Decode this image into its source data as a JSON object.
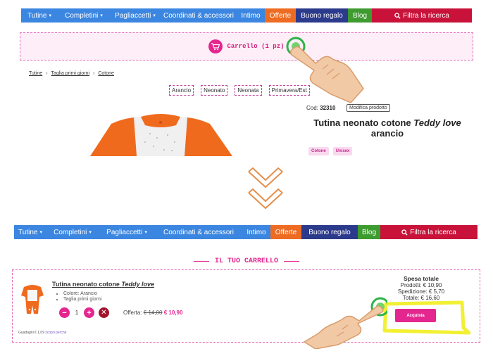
{
  "nav_top": {
    "items": [
      {
        "label": "Tutine",
        "caret": "▾",
        "kind": "blue"
      },
      {
        "label": "Completini",
        "caret": "▾",
        "kind": "blue"
      },
      {
        "label": "Pagliaccetti",
        "caret": "▾",
        "kind": "blue"
      },
      {
        "label": "Coordinati & accessori",
        "caret": "",
        "kind": "blue"
      },
      {
        "label": "Intimo",
        "caret": "",
        "kind": "blue"
      },
      {
        "label": "Offerte",
        "caret": "",
        "kind": "org"
      },
      {
        "label": "Buono regalo",
        "caret": "",
        "kind": "navy"
      },
      {
        "label": "Blog",
        "caret": "",
        "kind": "grn"
      },
      {
        "label": "Filtra la ricerca",
        "caret": "",
        "kind": "red",
        "icon": "search-icon"
      }
    ]
  },
  "cart_bar": {
    "label": "Carrello (1 pz)",
    "icon": "cart-icon"
  },
  "breadcrumb": [
    "Tutine",
    "Taglia primi giorni",
    "Cotone"
  ],
  "breadcrumb_sep": "›",
  "chips": [
    "Arancio",
    "Neonato",
    "Neonata",
    "Primavera/Est"
  ],
  "product": {
    "cod_label": "Cod:",
    "cod_value": "32310",
    "edit_button": "Modifica prodotto",
    "title_part1": "Tutina neonato cotone",
    "title_italic": "Teddy love",
    "title_part2": "arancio",
    "tags": [
      "Cotone",
      "Unisex"
    ]
  },
  "nav_bottom": {
    "items": [
      {
        "label": "Tutine",
        "caret": "▾",
        "kind": "blue"
      },
      {
        "label": "Completini",
        "caret": "▾",
        "kind": "blue"
      },
      {
        "label": "Pagliaccetti",
        "caret": "▾",
        "kind": "blue"
      },
      {
        "label": "Coordinati & accessori",
        "caret": "",
        "kind": "blue"
      },
      {
        "label": "Intimo",
        "caret": "",
        "kind": "blue"
      },
      {
        "label": "Offerte",
        "caret": "",
        "kind": "org"
      },
      {
        "label": "Buono regalo",
        "caret": "",
        "kind": "navy"
      },
      {
        "label": "Blog",
        "caret": "",
        "kind": "grn"
      },
      {
        "label": "Filtra la ricerca",
        "caret": "",
        "kind": "red",
        "icon": "search-icon"
      }
    ]
  },
  "cart_section": {
    "title": "IL TUO CARRELLO",
    "item": {
      "name_part1": "Tutina neonato cotone",
      "name_italic": "Teddy love",
      "attributes": [
        "Colore: Arancio",
        "Taglia primi giorni"
      ],
      "quantity": "1",
      "minus": "−",
      "plus": "+",
      "remove": "✕",
      "offer_label": "Offerta:",
      "old_price": "€ 14,00",
      "new_price": "€ 10,90"
    },
    "saved_text": "Guadagni € 1,09",
    "saved_link": "scopri perchè",
    "totals": {
      "heading": "Spesa totale",
      "products": "Prodotti: € 10,90",
      "shipping": "Spedizione: € 5,70",
      "total": "Totale: € 16,60"
    },
    "buy_button": "Acquista"
  },
  "colors": {
    "pink": "#e4268f",
    "nav_blue": "#3b86e0",
    "orange": "#ee6b22",
    "highlight": "#f2f033"
  }
}
